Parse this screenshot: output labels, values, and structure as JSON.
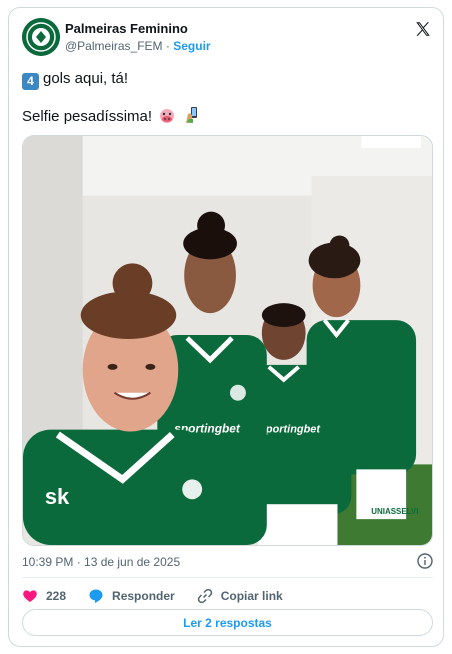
{
  "author": {
    "name": "Palmeiras Feminino",
    "handle": "@Palmeiras_FEM",
    "separator": "·",
    "follow_label": "Seguir"
  },
  "tweet": {
    "line1_keycap": "4",
    "line1_text": "gols aqui, tá!",
    "line2_text": "Selfie pesadíssima!",
    "line2_emojis": [
      "cow-face-emoji",
      "selfie-emoji"
    ]
  },
  "photo": {
    "description_icons": [
      "players-selfie-photo"
    ],
    "jersey_text": "sportingbet",
    "shorts_text": "UNIASSELVI"
  },
  "meta": {
    "timestamp": "10:39 PM · 13 de jun de 2025"
  },
  "actions": {
    "likes_count": "228",
    "reply_label": "Responder",
    "copy_label": "Copiar link"
  },
  "replies_button": {
    "label": "Ler 2 respostas"
  },
  "colors": {
    "accent": "#1d9bf0",
    "heart": "#f91880",
    "brand_green": "#0b6a3c"
  }
}
